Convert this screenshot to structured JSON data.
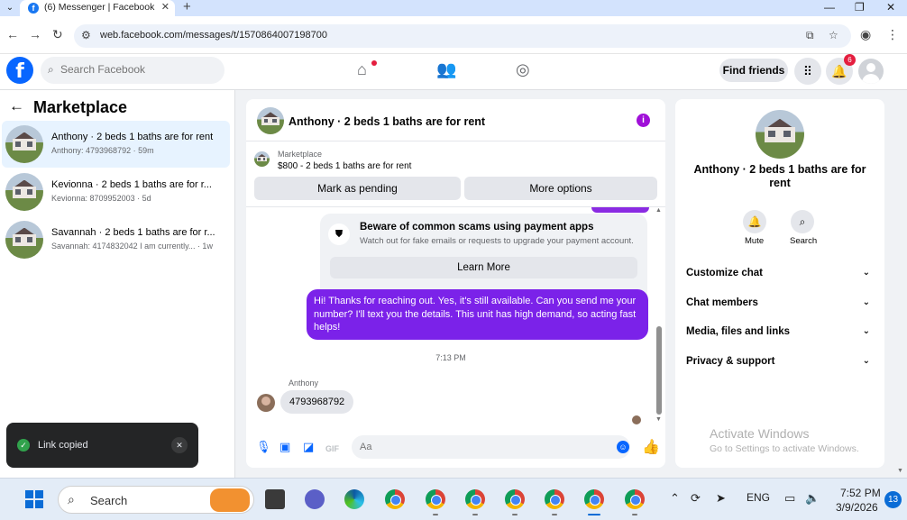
{
  "browser": {
    "tab_title": "(6) Messenger | Facebook",
    "url": "web.facebook.com/messages/t/1570864007198700",
    "new_tab": "+",
    "close_tab": "✕"
  },
  "fb_header": {
    "search_placeholder": "Search Facebook",
    "find_friends": "Find friends",
    "notification_count": "6"
  },
  "left_panel": {
    "title": "Marketplace",
    "conversations": [
      {
        "name": "Anthony · 2 beds 1 baths are for rent",
        "sub": "Anthony: 4793968792 · 59m",
        "active": true
      },
      {
        "name": "Kevionna · 2 beds 1 baths are for r...",
        "sub": "Kevionna: 8709952003 · 5d",
        "active": false
      },
      {
        "name": "Savannah · 2 beds 1 baths are for r...",
        "sub": "Savannah: 4174832042 I am currently... · 1w",
        "active": false
      }
    ]
  },
  "chat": {
    "title": "Anthony · 2 beds 1 baths are for rent",
    "marketplace_label": "Marketplace",
    "listing": "$800 - 2 beds 1 baths are for rent",
    "mark_pending": "Mark as pending",
    "more_options": "More options",
    "scam_title": "Beware of common scams using payment apps",
    "scam_sub": "Watch out for fake emails or requests to upgrade your payment account.",
    "learn_more": "Learn More",
    "outgoing_message": "Hi! Thanks for reaching out. Yes, it's still available. Can you send me your number? I'll text you the details. This unit has high demand, so acting fast helps!",
    "timestamp": "7:13 PM",
    "sender_name": "Anthony",
    "incoming_message": "4793968792",
    "composer_placeholder": "Aa"
  },
  "right_panel": {
    "title": "Anthony · 2 beds 1 baths are for rent",
    "mute": "Mute",
    "search": "Search",
    "rows": [
      "Customize chat",
      "Chat members",
      "Media, files and links",
      "Privacy & support"
    ],
    "activate_title": "Activate Windows",
    "activate_sub": "Go to Settings to activate Windows."
  },
  "toast": {
    "text": "Link copied"
  },
  "taskbar": {
    "search_label": "Search",
    "language": "ENG",
    "time": "7:52 PM",
    "date": "3/9/2026",
    "notifications": "13"
  },
  "colors": {
    "fb_blue": "#0866ff",
    "outgoing_bubble": "#7b22e9",
    "active_convo": "#e7f3ff",
    "badge_red": "#e41e3f"
  }
}
